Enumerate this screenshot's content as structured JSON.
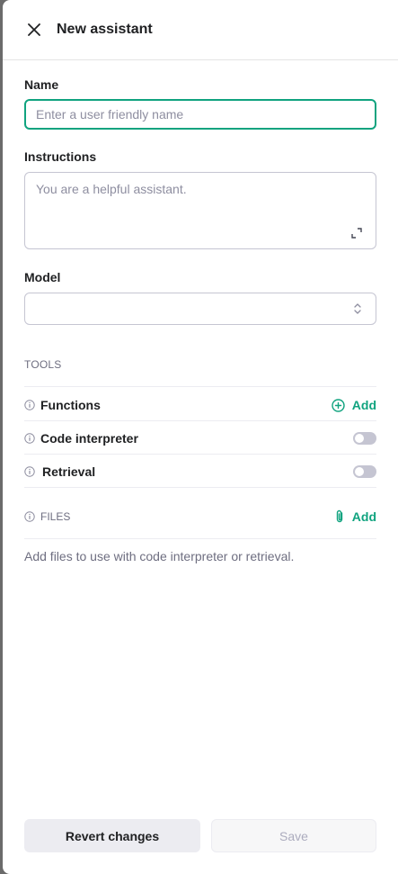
{
  "header": {
    "title": "New assistant"
  },
  "form": {
    "name_label": "Name",
    "name_placeholder": "Enter a user friendly name",
    "name_value": "",
    "instructions_label": "Instructions",
    "instructions_placeholder": "You are a helpful assistant.",
    "instructions_value": "",
    "model_label": "Model",
    "model_value": ""
  },
  "tools": {
    "heading": "TOOLS",
    "items": [
      {
        "label": "Functions",
        "control": "add",
        "action_label": "Add"
      },
      {
        "label": "Code interpreter",
        "control": "toggle",
        "enabled": false
      },
      {
        "label": "Retrieval",
        "control": "toggle",
        "enabled": false
      }
    ]
  },
  "files": {
    "heading": "FILES",
    "add_label": "Add",
    "hint": "Add files to use with code interpreter or retrieval."
  },
  "footer": {
    "revert_label": "Revert changes",
    "save_label": "Save"
  },
  "colors": {
    "accent": "#10a37f",
    "toggle_off": "#c5c5d2",
    "backdrop": "#6b6b6b"
  },
  "icons": {
    "close": "close-icon",
    "expand": "expand-icon",
    "select": "chevron-updown-icon",
    "info": "info-icon",
    "add": "plus-circle-icon",
    "attach": "paperclip-icon"
  }
}
